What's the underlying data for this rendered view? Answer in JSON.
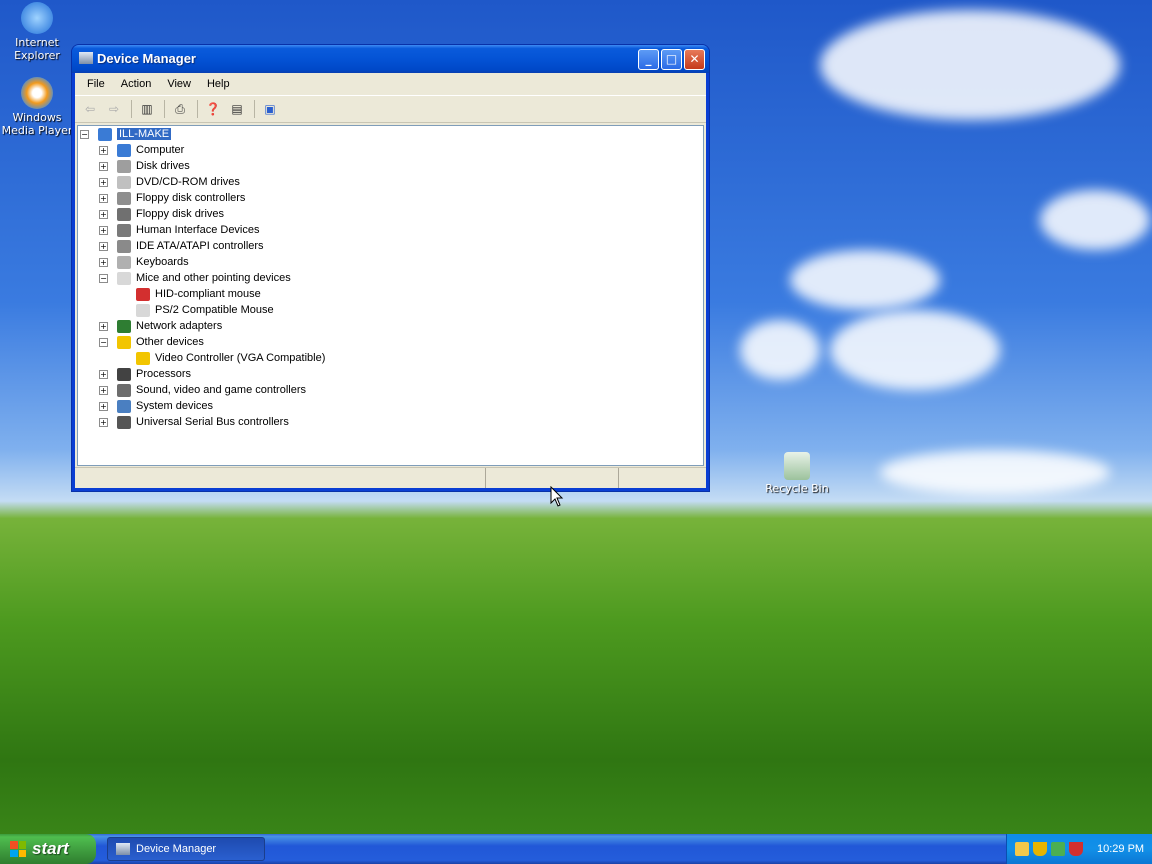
{
  "desktop": {
    "icons": [
      {
        "label": "Internet Explorer",
        "icon": "internet-explorer-icon"
      },
      {
        "label": "Windows Media Player",
        "icon": "windows-media-player-icon"
      },
      {
        "label": "Recycle Bin",
        "icon": "recycle-bin-icon"
      }
    ]
  },
  "window": {
    "title": "Device Manager",
    "menu": [
      "File",
      "Action",
      "View",
      "Help"
    ],
    "toolbar": [
      "back-icon",
      "forward-icon",
      "show-hide-console-tree-icon",
      "print-icon",
      "properties-icon",
      "help-icon",
      "scan-hardware-icon"
    ],
    "tree": {
      "root": "ILL-MAKE",
      "items": [
        {
          "label": "Computer",
          "icon": "computer-icon",
          "expanded": false
        },
        {
          "label": "Disk drives",
          "icon": "disk-drive-icon",
          "expanded": false
        },
        {
          "label": "DVD/CD-ROM drives",
          "icon": "cdrom-icon",
          "expanded": false
        },
        {
          "label": "Floppy disk controllers",
          "icon": "floppy-controller-icon",
          "expanded": false
        },
        {
          "label": "Floppy disk drives",
          "icon": "floppy-drive-icon",
          "expanded": false
        },
        {
          "label": "Human Interface Devices",
          "icon": "hid-icon",
          "expanded": false
        },
        {
          "label": "IDE ATA/ATAPI controllers",
          "icon": "ide-controller-icon",
          "expanded": false
        },
        {
          "label": "Keyboards",
          "icon": "keyboard-icon",
          "expanded": false
        },
        {
          "label": "Mice and other pointing devices",
          "icon": "mouse-icon",
          "expanded": true,
          "children": [
            {
              "label": "HID-compliant mouse",
              "icon": "disabled-device-icon"
            },
            {
              "label": "PS/2 Compatible Mouse",
              "icon": "mouse-icon"
            }
          ]
        },
        {
          "label": "Network adapters",
          "icon": "network-adapter-icon",
          "expanded": false
        },
        {
          "label": "Other devices",
          "icon": "unknown-device-icon",
          "expanded": true,
          "children": [
            {
              "label": "Video Controller (VGA Compatible)",
              "icon": "warning-device-icon"
            }
          ]
        },
        {
          "label": "Processors",
          "icon": "processor-icon",
          "expanded": false
        },
        {
          "label": "Sound, video and game controllers",
          "icon": "sound-icon",
          "expanded": false
        },
        {
          "label": "System devices",
          "icon": "system-device-icon",
          "expanded": false
        },
        {
          "label": "Universal Serial Bus controllers",
          "icon": "usb-icon",
          "expanded": false
        }
      ]
    }
  },
  "taskbar": {
    "start_label": "start",
    "task_label": "Device Manager",
    "clock": "10:29 PM"
  },
  "colors": {
    "title_blue": "#0453d5",
    "selection": "#316ac5",
    "start_green": "#3d993d"
  }
}
